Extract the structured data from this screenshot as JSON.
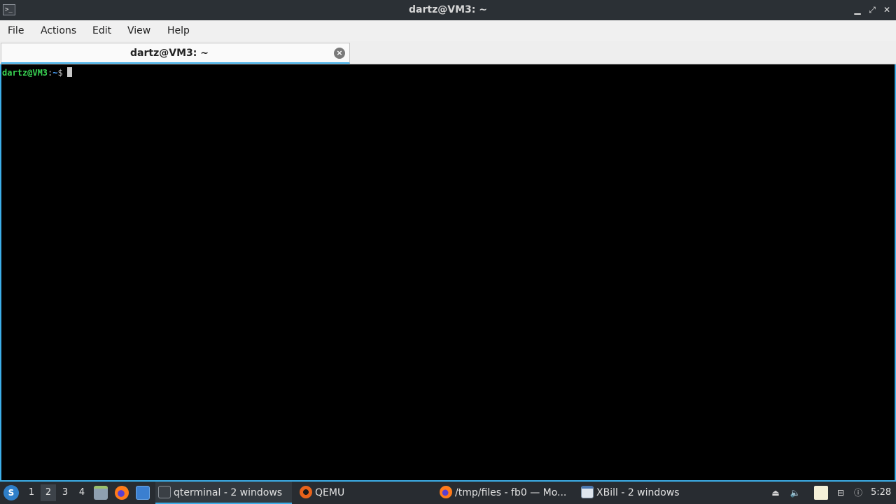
{
  "window": {
    "title": "dartz@VM3: ~",
    "icon": "terminal-icon",
    "controls": {
      "minimize": "▁",
      "restore": "⤢",
      "close": "✕"
    }
  },
  "menubar": {
    "items": [
      "File",
      "Actions",
      "Edit",
      "View",
      "Help"
    ]
  },
  "tabs": [
    {
      "label": "dartz@VM3: ~",
      "close_icon": "close-circle-icon",
      "close_glyph": "×"
    }
  ],
  "terminal": {
    "prompt_user": "dartz@VM3",
    "prompt_sep": ":",
    "prompt_path": "~",
    "prompt_symbol": "$"
  },
  "taskbar": {
    "start_glyph": "S",
    "desktops": [
      "1",
      "2",
      "3",
      "4"
    ],
    "active_desktop": "2",
    "launchers": [
      "file-manager-icon",
      "firefox-icon",
      "show-desktop-icon"
    ],
    "tasks": [
      {
        "label": "qterminal - 2 windows",
        "icon": "terminal-icon",
        "active": true
      },
      {
        "label": "QEMU",
        "icon": "qemu-icon",
        "active": false
      },
      {
        "label": "/tmp/files - fb0 — Mo...",
        "icon": "firefox-icon",
        "active": false
      },
      {
        "label": "XBill - 2 windows",
        "icon": "window-icon",
        "active": false
      }
    ],
    "tray": [
      "eject-icon",
      "volume-icon",
      "clipboard-icon",
      "network-icon",
      "notification-icon"
    ],
    "clock": "5:28"
  },
  "colors": {
    "accent": "#3daee9",
    "prompt_user": "#39d353",
    "prompt_path": "#4aa3ff",
    "terminal_bg": "#000000",
    "titlebar_bg": "#2b3035",
    "taskbar_bg": "#282c31"
  }
}
